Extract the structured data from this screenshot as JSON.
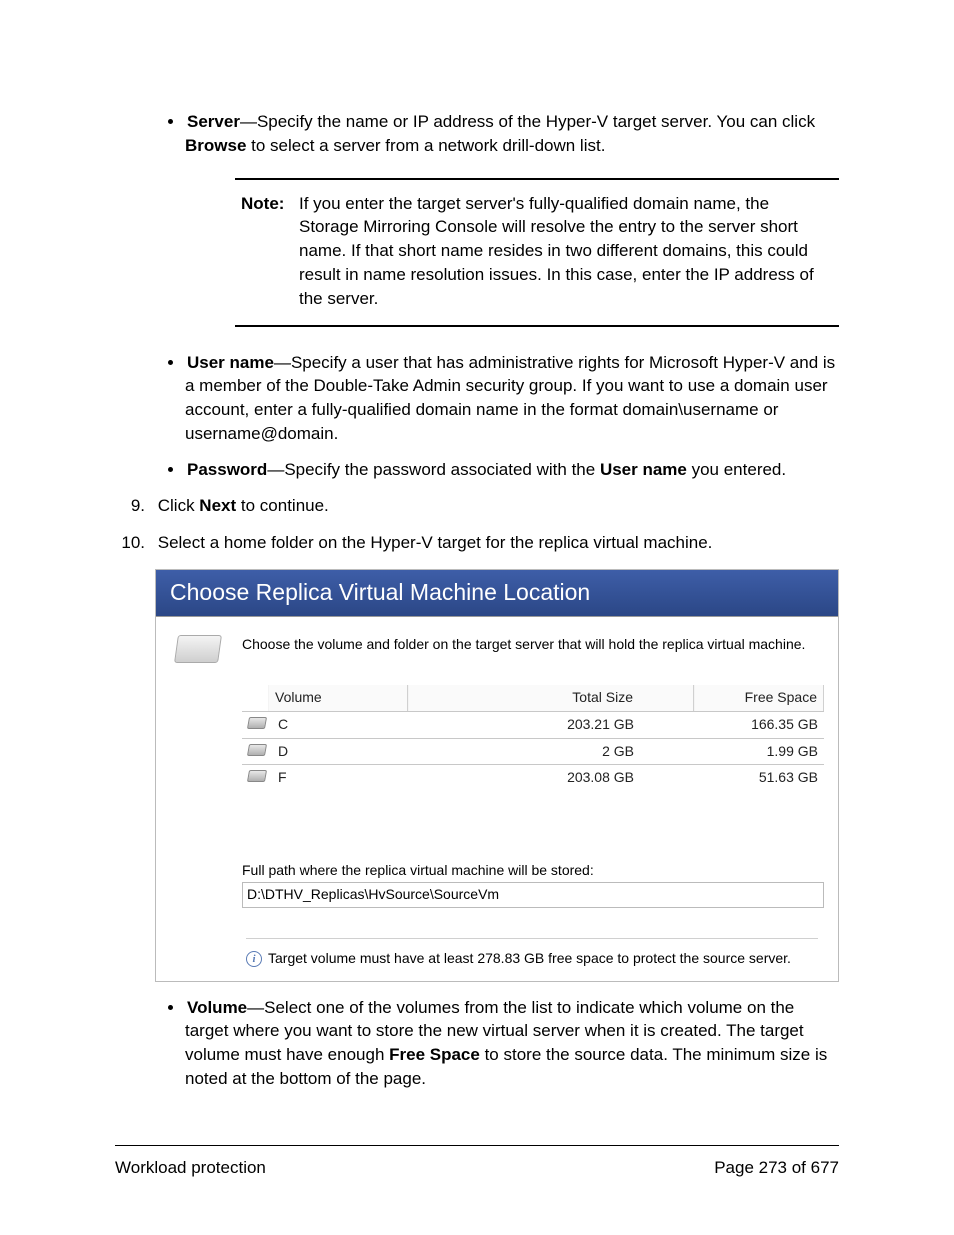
{
  "bullets1": {
    "server": {
      "label": "Server",
      "text": "—Specify the name or IP address of the Hyper-V target server. You can click ",
      "browse": "Browse",
      "text2": " to select a server from a network drill-down list."
    },
    "note": {
      "label": "Note:",
      "text": "If you enter the target server's fully-qualified domain name, the Storage Mirroring Console will resolve the entry to the server short name. If that short name resides in two different domains, this could result in name resolution issues. In this case, enter the IP address of the server."
    },
    "username": {
      "label": "User name",
      "text": "—Specify a user that has administrative rights for Microsoft Hyper-V and is a member of the Double-Take Admin security group. If you want to use a domain user account, enter a fully-qualified domain name in the format domain\\username or username@domain."
    },
    "password": {
      "label": "Password",
      "text1": "—Specify the password associated with the ",
      "un": "User name",
      "text2": " you entered."
    }
  },
  "step9": {
    "num": "9.",
    "text1": "Click ",
    "next": "Next",
    "text2": " to continue."
  },
  "step10": {
    "num": "10.",
    "text": "Select a home folder on the Hyper-V target for the replica virtual machine."
  },
  "figure": {
    "title": "Choose Replica Virtual Machine Location",
    "desc": "Choose the volume and folder on the target server that will hold the replica virtual machine.",
    "head": {
      "volume": "Volume",
      "total": "Total Size",
      "free": "Free Space"
    },
    "rows": [
      {
        "vol": "C",
        "total": "203.21 GB",
        "free": "166.35 GB"
      },
      {
        "vol": "D",
        "total": "2 GB",
        "free": "1.99 GB"
      },
      {
        "vol": "F",
        "total": "203.08 GB",
        "free": "51.63 GB"
      }
    ],
    "pathlabel": "Full path where the replica virtual machine will be stored:",
    "pathvalue": "D:\\DTHV_Replicas\\HvSource\\SourceVm",
    "info": "Target volume must have at least 278.83 GB free space to protect the source server."
  },
  "bullets2": {
    "volume": {
      "label": "Volume",
      "t1": "—Select one of the volumes from the list to indicate which volume on the target where you want to store the new virtual server when it is created. The target volume must have enough ",
      "fs": "Free Space",
      "t2": " to store the source data. The minimum size is noted at the bottom of the page."
    }
  },
  "footer": {
    "left": "Workload protection",
    "right": "Page 273 of 677"
  }
}
